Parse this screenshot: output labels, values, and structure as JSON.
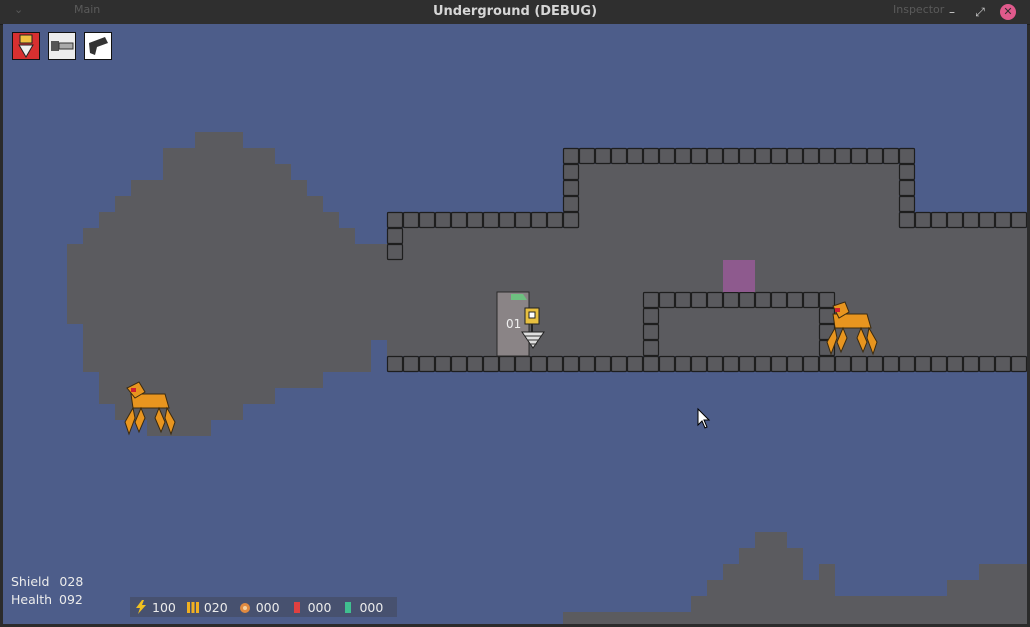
{
  "window": {
    "title": "Underground (DEBUG)",
    "left_tab_label": "Main",
    "inspector_label": "Inspector",
    "accent_close": "#e05a8c"
  },
  "toolbar": {
    "tools": [
      {
        "name": "drill-tool",
        "selected": true
      },
      {
        "name": "chainsaw-tool",
        "selected": false
      },
      {
        "name": "gun-tool",
        "selected": false
      }
    ]
  },
  "door": {
    "label": "01"
  },
  "hud": {
    "shield_label": "Shield",
    "shield_value": "028",
    "health_label": "Health",
    "health_value": "092",
    "resources": [
      {
        "icon": "energy-icon",
        "value": "100",
        "color": "#f0c020"
      },
      {
        "icon": "ammo-icon",
        "value": "020",
        "color": "#f0b020"
      },
      {
        "icon": "ore-icon",
        "value": "000",
        "color": "#e08a40"
      },
      {
        "icon": "red-crystal-icon",
        "value": "000",
        "color": "#e04040"
      },
      {
        "icon": "green-crystal-icon",
        "value": "000",
        "color": "#40c090"
      }
    ]
  },
  "colors": {
    "sky": "#4d5d8a",
    "rock": "#5b5b5f",
    "block": "#5a5a5e",
    "block_border": "#1e1e1e",
    "crate": "#8e5a8e",
    "enemy": "#e8951f"
  }
}
